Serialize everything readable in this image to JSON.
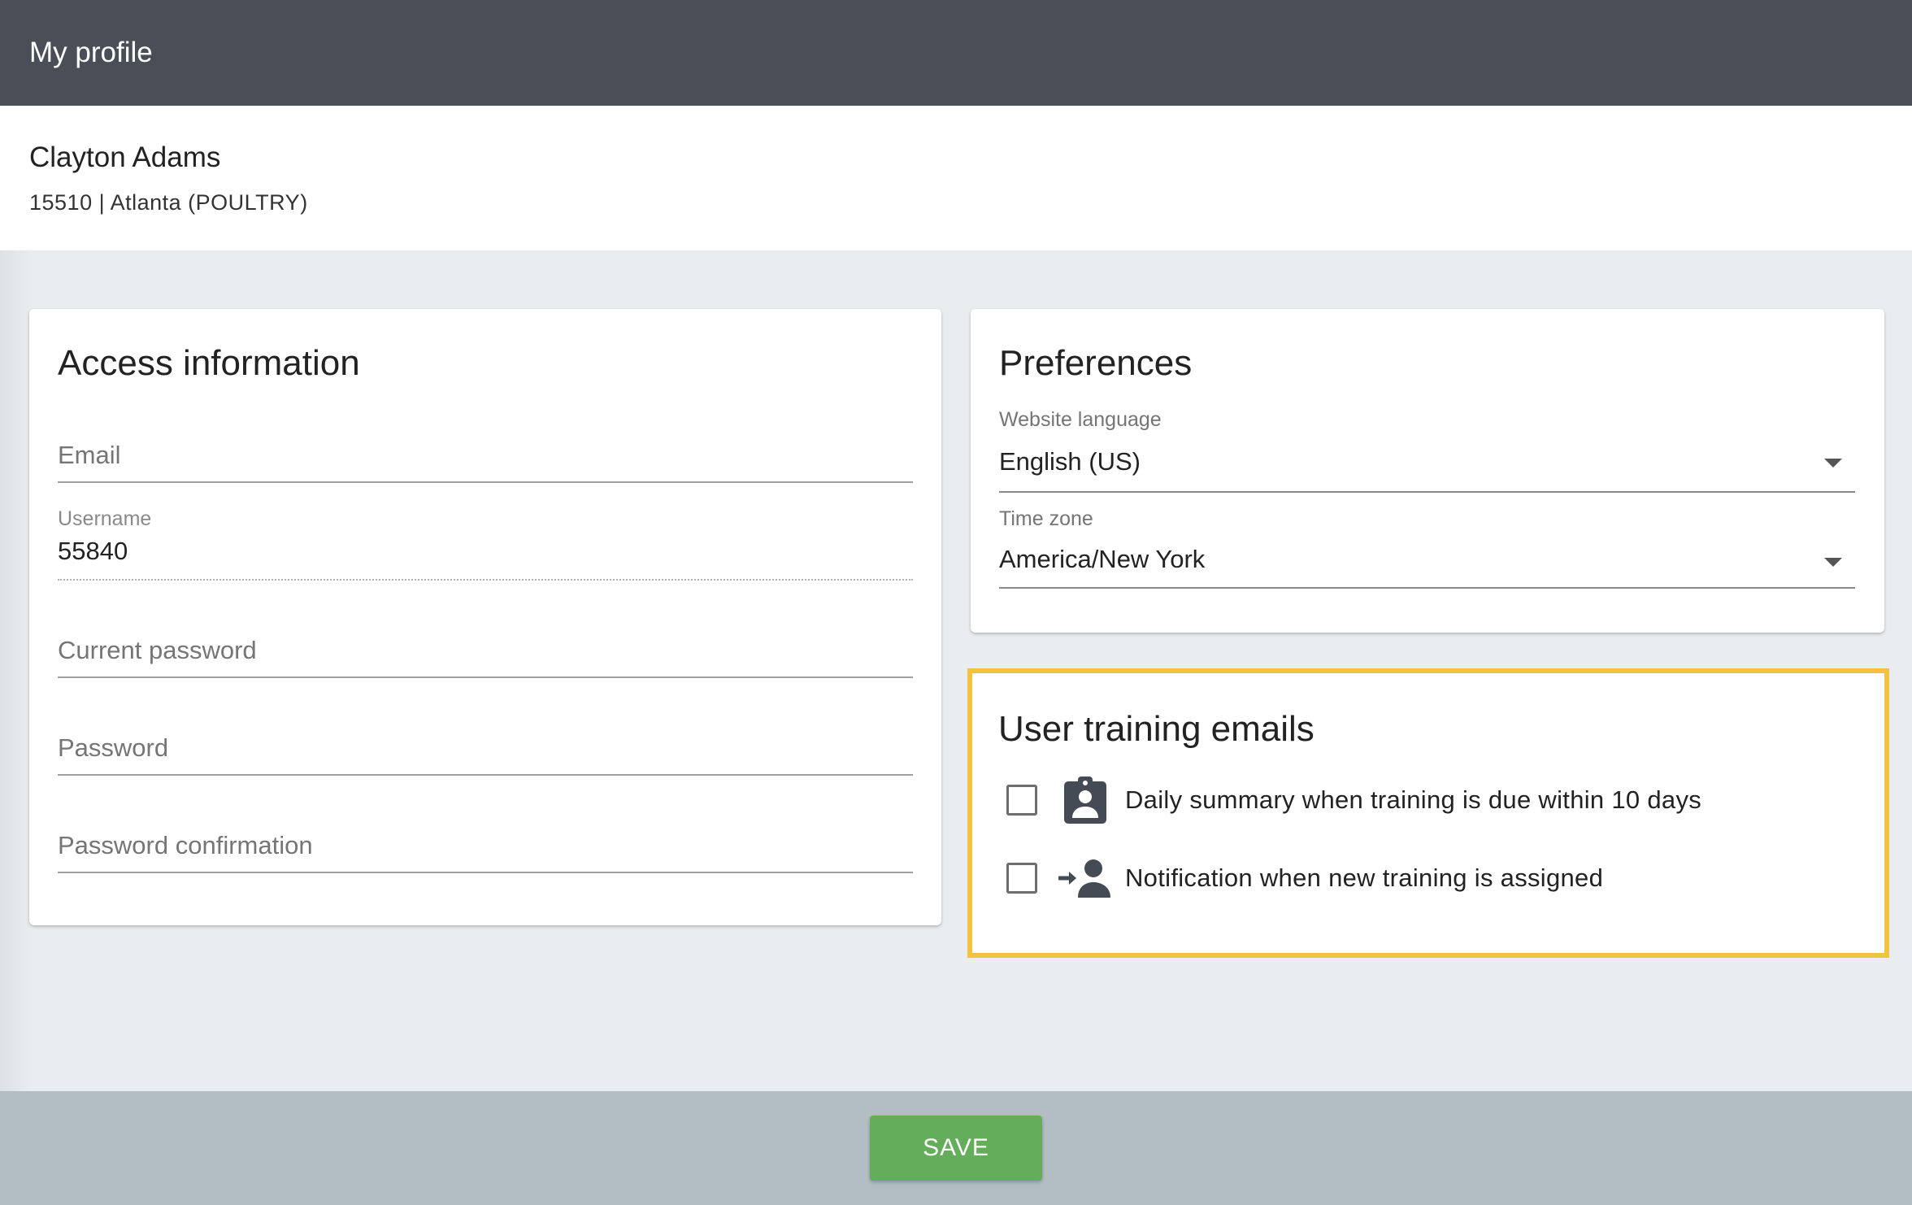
{
  "header": {
    "title": "My profile"
  },
  "profile": {
    "name": "Clayton Adams",
    "meta": "15510 | Atlanta (POULTRY)"
  },
  "access": {
    "title": "Access information",
    "email": {
      "placeholder": "Email",
      "value": ""
    },
    "username": {
      "label": "Username",
      "value": "55840"
    },
    "current_password": {
      "placeholder": "Current password"
    },
    "password": {
      "placeholder": "Password"
    },
    "password_confirmation": {
      "placeholder": "Password confirmation"
    }
  },
  "preferences": {
    "title": "Preferences",
    "language": {
      "label": "Website language",
      "value": "English (US)"
    },
    "timezone": {
      "label": "Time zone",
      "value": "America/New York"
    }
  },
  "training_emails": {
    "title": "User training emails",
    "options": [
      {
        "label": "Daily summary when training is due within 10 days",
        "checked": false,
        "icon": "assignment-ind-icon"
      },
      {
        "label": "Notification when new training is assigned",
        "checked": false,
        "icon": "person-arrow-icon"
      }
    ]
  },
  "footer": {
    "save_label": "SAVE"
  },
  "colors": {
    "topbar": "#4a4f57",
    "highlight_border": "#f2c241",
    "save_button": "#64ad5a",
    "footer": "#b3bec4"
  }
}
